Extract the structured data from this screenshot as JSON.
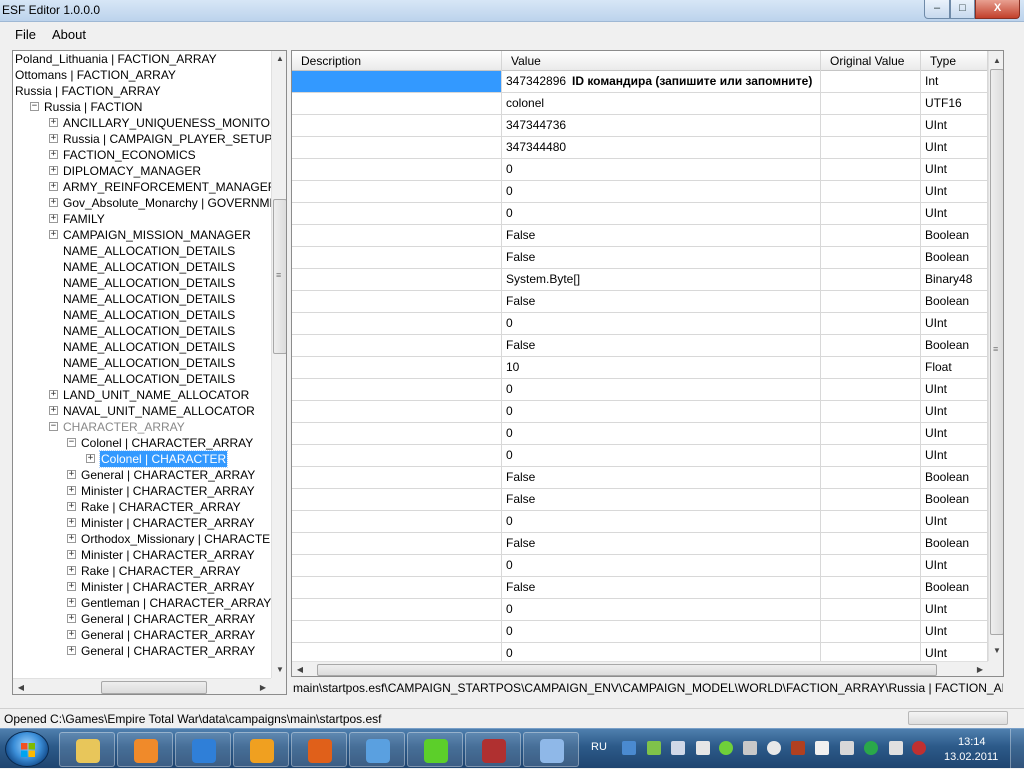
{
  "window": {
    "title": "ESF Editor 1.0.0.0",
    "controls": {
      "minimize": "–",
      "maximize": "□",
      "close": "X"
    }
  },
  "menu": {
    "file": "File",
    "about": "About"
  },
  "tree": {
    "nodes": [
      {
        "label": "Poland_Lithuania | FACTION_ARRAY",
        "indent": 0,
        "expander": "none"
      },
      {
        "label": "Ottomans | FACTION_ARRAY",
        "indent": 0,
        "expander": "none"
      },
      {
        "label": "Russia | FACTION_ARRAY",
        "indent": 0,
        "expander": "none"
      },
      {
        "label": "Russia | FACTION",
        "indent": 1,
        "expander": "minus"
      },
      {
        "label": "ANCILLARY_UNIQUENESS_MONITOR",
        "indent": 2,
        "expander": "plus"
      },
      {
        "label": "Russia | CAMPAIGN_PLAYER_SETUP",
        "indent": 2,
        "expander": "plus"
      },
      {
        "label": "FACTION_ECONOMICS",
        "indent": 2,
        "expander": "plus"
      },
      {
        "label": "DIPLOMACY_MANAGER",
        "indent": 2,
        "expander": "plus"
      },
      {
        "label": "ARMY_REINFORCEMENT_MANAGER",
        "indent": 2,
        "expander": "plus"
      },
      {
        "label": "Gov_Absolute_Monarchy | GOVERNMENT",
        "indent": 2,
        "expander": "plus"
      },
      {
        "label": "FAMILY",
        "indent": 2,
        "expander": "plus"
      },
      {
        "label": "CAMPAIGN_MISSION_MANAGER",
        "indent": 2,
        "expander": "plus"
      },
      {
        "label": "NAME_ALLOCATION_DETAILS",
        "indent": 2,
        "expander": "none"
      },
      {
        "label": "NAME_ALLOCATION_DETAILS",
        "indent": 2,
        "expander": "none"
      },
      {
        "label": "NAME_ALLOCATION_DETAILS",
        "indent": 2,
        "expander": "none"
      },
      {
        "label": "NAME_ALLOCATION_DETAILS",
        "indent": 2,
        "expander": "none"
      },
      {
        "label": "NAME_ALLOCATION_DETAILS",
        "indent": 2,
        "expander": "none"
      },
      {
        "label": "NAME_ALLOCATION_DETAILS",
        "indent": 2,
        "expander": "none"
      },
      {
        "label": "NAME_ALLOCATION_DETAILS",
        "indent": 2,
        "expander": "none"
      },
      {
        "label": "NAME_ALLOCATION_DETAILS",
        "indent": 2,
        "expander": "none"
      },
      {
        "label": "NAME_ALLOCATION_DETAILS",
        "indent": 2,
        "expander": "none"
      },
      {
        "label": "LAND_UNIT_NAME_ALLOCATOR",
        "indent": 2,
        "expander": "plus"
      },
      {
        "label": "NAVAL_UNIT_NAME_ALLOCATOR",
        "indent": 2,
        "expander": "plus"
      },
      {
        "label": "CHARACTER_ARRAY",
        "indent": 2,
        "expander": "minus",
        "grey": true
      },
      {
        "label": "Colonel | CHARACTER_ARRAY",
        "indent": 3,
        "expander": "minus"
      },
      {
        "label": "Colonel | CHARACTER",
        "indent": 4,
        "expander": "plus",
        "selected": true
      },
      {
        "label": "General | CHARACTER_ARRAY",
        "indent": 3,
        "expander": "plus"
      },
      {
        "label": "Minister | CHARACTER_ARRAY",
        "indent": 3,
        "expander": "plus"
      },
      {
        "label": "Rake | CHARACTER_ARRAY",
        "indent": 3,
        "expander": "plus"
      },
      {
        "label": "Minister | CHARACTER_ARRAY",
        "indent": 3,
        "expander": "plus"
      },
      {
        "label": "Orthodox_Missionary | CHARACTER_ARRAY",
        "indent": 3,
        "expander": "plus"
      },
      {
        "label": "Minister | CHARACTER_ARRAY",
        "indent": 3,
        "expander": "plus"
      },
      {
        "label": "Rake | CHARACTER_ARRAY",
        "indent": 3,
        "expander": "plus"
      },
      {
        "label": "Minister | CHARACTER_ARRAY",
        "indent": 3,
        "expander": "plus"
      },
      {
        "label": "Gentleman | CHARACTER_ARRAY",
        "indent": 3,
        "expander": "plus"
      },
      {
        "label": "General | CHARACTER_ARRAY",
        "indent": 3,
        "expander": "plus"
      },
      {
        "label": "General | CHARACTER_ARRAY",
        "indent": 3,
        "expander": "plus"
      },
      {
        "label": "General | CHARACTER_ARRAY",
        "indent": 3,
        "expander": "plus"
      }
    ],
    "vscroll_position": 0.3,
    "hscroll_position": 0.6
  },
  "grid": {
    "columns": {
      "description": "Description",
      "value": "Value",
      "original": "Original Value",
      "type": "Type"
    },
    "annotation": "ID командира (запишите или запомните)",
    "rows": [
      {
        "value": "347342896",
        "type": "Int",
        "selected": true
      },
      {
        "value": "colonel",
        "type": "UTF16"
      },
      {
        "value": "347344736",
        "type": "UInt"
      },
      {
        "value": "347344480",
        "type": "UInt"
      },
      {
        "value": "0",
        "type": "UInt"
      },
      {
        "value": "0",
        "type": "UInt"
      },
      {
        "value": "0",
        "type": "UInt"
      },
      {
        "value": "False",
        "type": "Boolean"
      },
      {
        "value": "False",
        "type": "Boolean"
      },
      {
        "value": "System.Byte[]",
        "type": "Binary48"
      },
      {
        "value": "False",
        "type": "Boolean"
      },
      {
        "value": "0",
        "type": "UInt"
      },
      {
        "value": "False",
        "type": "Boolean"
      },
      {
        "value": "10",
        "type": "Float"
      },
      {
        "value": "0",
        "type": "UInt"
      },
      {
        "value": "0",
        "type": "UInt"
      },
      {
        "value": "0",
        "type": "UInt"
      },
      {
        "value": "0",
        "type": "UInt"
      },
      {
        "value": "False",
        "type": "Boolean"
      },
      {
        "value": "False",
        "type": "Boolean"
      },
      {
        "value": "0",
        "type": "UInt"
      },
      {
        "value": "False",
        "type": "Boolean"
      },
      {
        "value": "0",
        "type": "UInt"
      },
      {
        "value": "False",
        "type": "Boolean"
      },
      {
        "value": "0",
        "type": "UInt"
      },
      {
        "value": "0",
        "type": "UInt"
      },
      {
        "value": "0",
        "type": "UInt"
      }
    ],
    "hscroll_position": 0.2
  },
  "path": "main\\startpos.esf\\CAMPAIGN_STARTPOS\\CAMPAIGN_ENV\\CAMPAIGN_MODEL\\WORLD\\FACTION_ARRAY\\Russia | FACTION_ARRAY\\Russia",
  "status": {
    "text": "Opened C:\\Games\\Empire Total War\\data\\campaigns\\main\\startpos.esf"
  },
  "taskbar": {
    "apps": [
      {
        "name": "explorer-icon",
        "color": "#e8c65a"
      },
      {
        "name": "media-player-icon",
        "color": "#f08a2a"
      },
      {
        "name": "internet-explorer-icon",
        "color": "#2f7fd8"
      },
      {
        "name": "mail-at-icon",
        "color": "#f0a020"
      },
      {
        "name": "firefox-icon",
        "color": "#e0601a"
      },
      {
        "name": "safari-compass-icon",
        "color": "#5aa0e0"
      },
      {
        "name": "icq-flower-icon",
        "color": "#5ccf2a"
      },
      {
        "name": "esf-editor-icon",
        "color": "#b03030"
      },
      {
        "name": "paint-icon",
        "color": "#8fb8e8"
      }
    ],
    "language": "RU",
    "clock": {
      "time": "13:14",
      "date": "13.02.2011"
    }
  },
  "colors": {
    "selection": "#3399ff",
    "taskbar": "#2c5a89"
  }
}
